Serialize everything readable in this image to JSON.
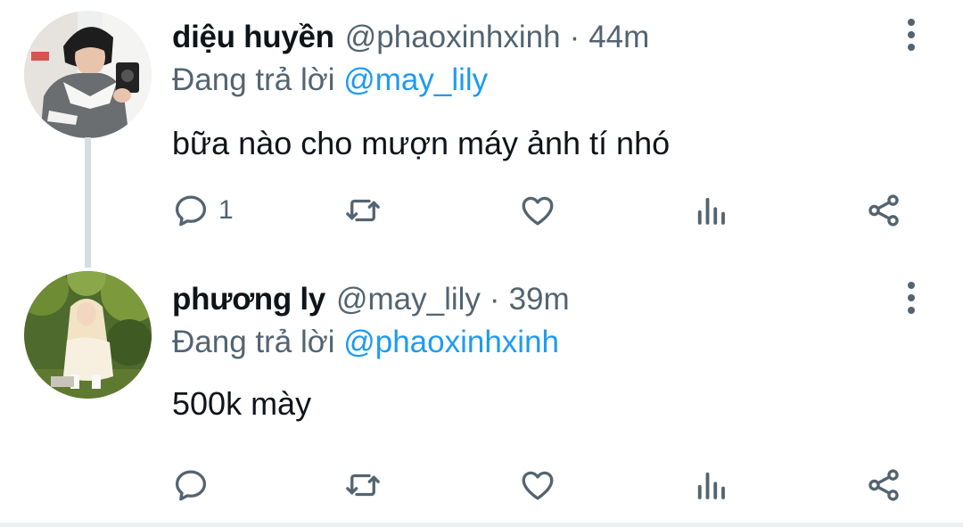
{
  "tweets": [
    {
      "display_name": "diệu huyền",
      "handle": "@phaoxinhxinh",
      "separator": "·",
      "time": "44m",
      "replying_prefix": "Đang trả lời",
      "replying_to": "@may_lily",
      "text": "bữa nào cho mượn máy ảnh tí nhó",
      "reply_count": "1",
      "avatar_icon": "user-photo-avatar"
    },
    {
      "display_name": "phương ly",
      "handle": "@may_lily",
      "separator": "·",
      "time": "39m",
      "replying_prefix": "Đang trả lời",
      "replying_to": "@phaoxinhxinh",
      "text": "500k mày",
      "reply_count": "",
      "avatar_icon": "user-photo-avatar"
    }
  ],
  "icons": {
    "reply": "reply-bubble-icon",
    "retweet": "retweet-icon",
    "like": "heart-icon",
    "views": "views-bar-chart-icon",
    "share": "share-icon",
    "more": "more-vertical-icon"
  },
  "colors": {
    "text_primary": "#0f1419",
    "text_secondary": "#536471",
    "link": "#1d9bf0",
    "thread_line": "#d6dde2"
  }
}
